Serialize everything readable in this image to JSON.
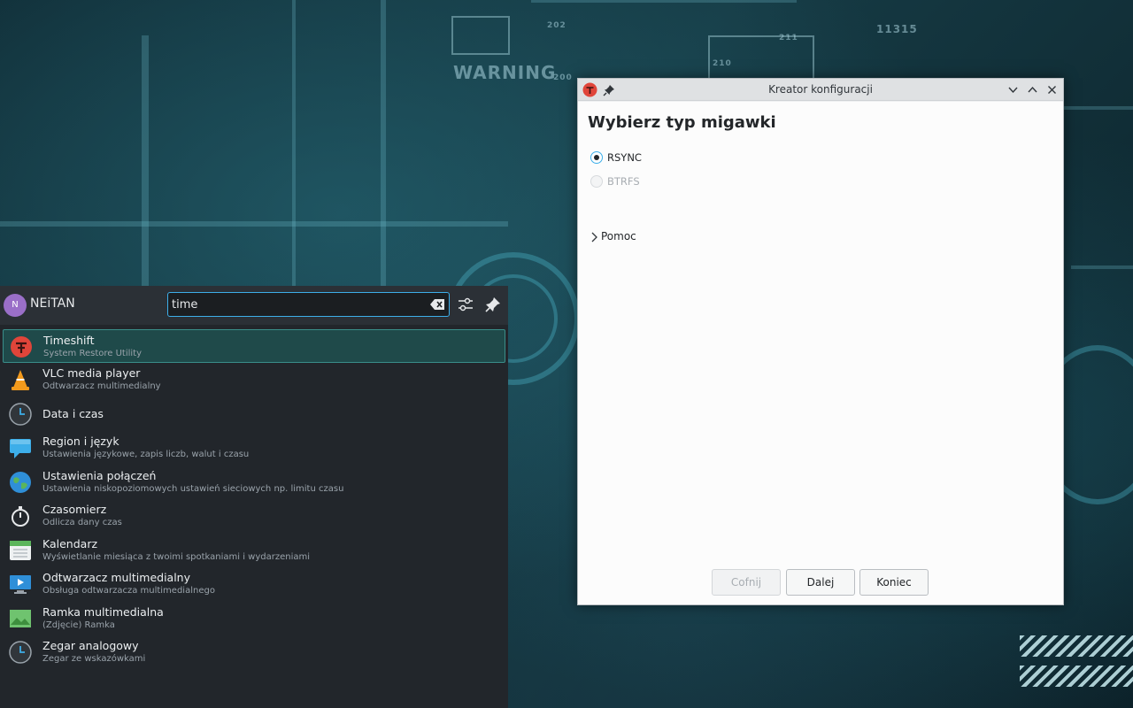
{
  "wallpaper": {
    "warning_text": "WARNING",
    "labels": [
      "202",
      "200",
      "211",
      "210",
      "11315"
    ]
  },
  "launcher": {
    "user": {
      "initial": "N",
      "name": "NEiTAN"
    },
    "search": {
      "value": "time",
      "placeholder": ""
    },
    "icons": {
      "clear": "backspace-icon",
      "filter": "sliders-icon",
      "pin": "pin-icon"
    },
    "results": [
      {
        "title": "Timeshift",
        "subtitle": "System Restore Utility",
        "icon": "timeshift-icon"
      },
      {
        "title": "VLC media player",
        "subtitle": "Odtwarzacz multimedialny",
        "icon": "vlc-icon"
      },
      {
        "title": "Data i czas",
        "subtitle": "",
        "icon": "clock-icon"
      },
      {
        "title": "Region i język",
        "subtitle": "Ustawienia językowe, zapis liczb, walut i czasu",
        "icon": "speech-bubble-icon"
      },
      {
        "title": "Ustawienia połączeń",
        "subtitle": "Ustawienia niskopoziomowych ustawień sieciowych np. limitu czasu",
        "icon": "globe-icon"
      },
      {
        "title": "Czasomierz",
        "subtitle": "Odlicza dany czas",
        "icon": "stopwatch-icon"
      },
      {
        "title": "Kalendarz",
        "subtitle": "Wyświetlanie miesiąca z twoimi spotkaniami i wydarzeniami",
        "icon": "calendar-icon"
      },
      {
        "title": "Odtwarzacz multimedialny",
        "subtitle": "Obsługa odtwarzacza multimedialnego",
        "icon": "media-player-icon"
      },
      {
        "title": "Ramka multimedialna",
        "subtitle": "(Zdjęcie) Ramka",
        "icon": "picture-frame-icon"
      },
      {
        "title": "Zegar analogowy",
        "subtitle": "Zegar ze wskazówkami",
        "icon": "analog-clock-icon"
      }
    ]
  },
  "dialog": {
    "window_title": "Kreator konfiguracji",
    "heading": "Wybierz typ migawki",
    "options": [
      {
        "label": "RSYNC",
        "checked": true,
        "enabled": true
      },
      {
        "label": "BTRFS",
        "checked": false,
        "enabled": false
      }
    ],
    "help_label": "Pomoc",
    "buttons": {
      "back": "Cofnij",
      "next": "Dalej",
      "finish": "Koniec"
    },
    "colors": {
      "accent": "#3daee9",
      "timeshift_red": "#e0453a"
    }
  }
}
